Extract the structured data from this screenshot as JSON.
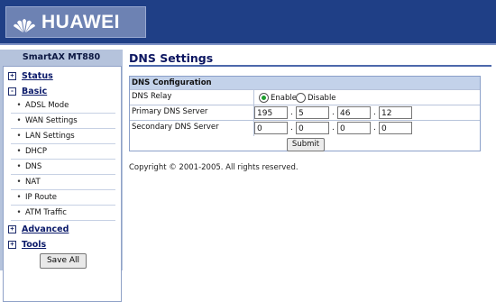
{
  "header": {
    "brand": "HUAWEI"
  },
  "sidebar": {
    "model": "SmartAX MT880",
    "menu": [
      {
        "label": "Status",
        "toggle": "+"
      },
      {
        "label": "Basic",
        "toggle": "-",
        "items": [
          "ADSL Mode",
          "WAN Settings",
          "LAN Settings",
          "DHCP",
          "DNS",
          "NAT",
          "IP Route",
          "ATM Traffic"
        ]
      },
      {
        "label": "Advanced",
        "toggle": "+"
      },
      {
        "label": "Tools",
        "toggle": "+"
      }
    ],
    "save_all": "Save All"
  },
  "main": {
    "title": "DNS Settings",
    "panel_title": "DNS Configuration",
    "dns_relay": {
      "label": "DNS Relay",
      "enable": "Enable",
      "disable": "Disable",
      "selected": "Enable"
    },
    "primary": {
      "label": "Primary DNS Server",
      "octets": [
        "195",
        "5",
        "46",
        "12"
      ]
    },
    "secondary": {
      "label": "Secondary DNS Server",
      "octets": [
        "0",
        "0",
        "0",
        "0"
      ]
    },
    "submit": "Submit"
  },
  "footer": {
    "copyright": "Copyright © 2001-2005. All rights reserved."
  },
  "colors": {
    "header_bg": "#1f3f86",
    "sidebar_bg": "#b5c3dc",
    "panel_head": "#c3d2ea"
  }
}
